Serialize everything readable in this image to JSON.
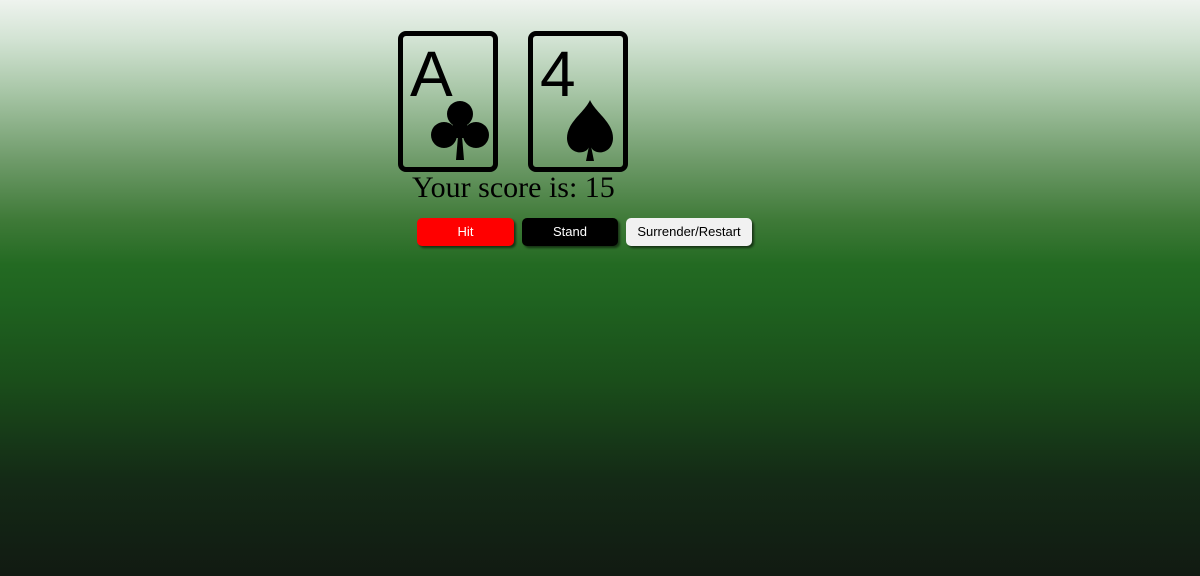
{
  "cards": [
    {
      "rank": "A",
      "suit": "clubs",
      "suit_icon": "club-icon"
    },
    {
      "rank": "4",
      "suit": "spades",
      "suit_icon": "spade-icon"
    }
  ],
  "score": {
    "text": "Your score is: 15",
    "value": 15
  },
  "buttons": {
    "hit": {
      "label": "Hit",
      "color": "#ff0000"
    },
    "stand": {
      "label": "Stand",
      "color": "#000000"
    },
    "surrender": {
      "label": "Surrender/Restart",
      "color": "#f1f1f1"
    }
  }
}
